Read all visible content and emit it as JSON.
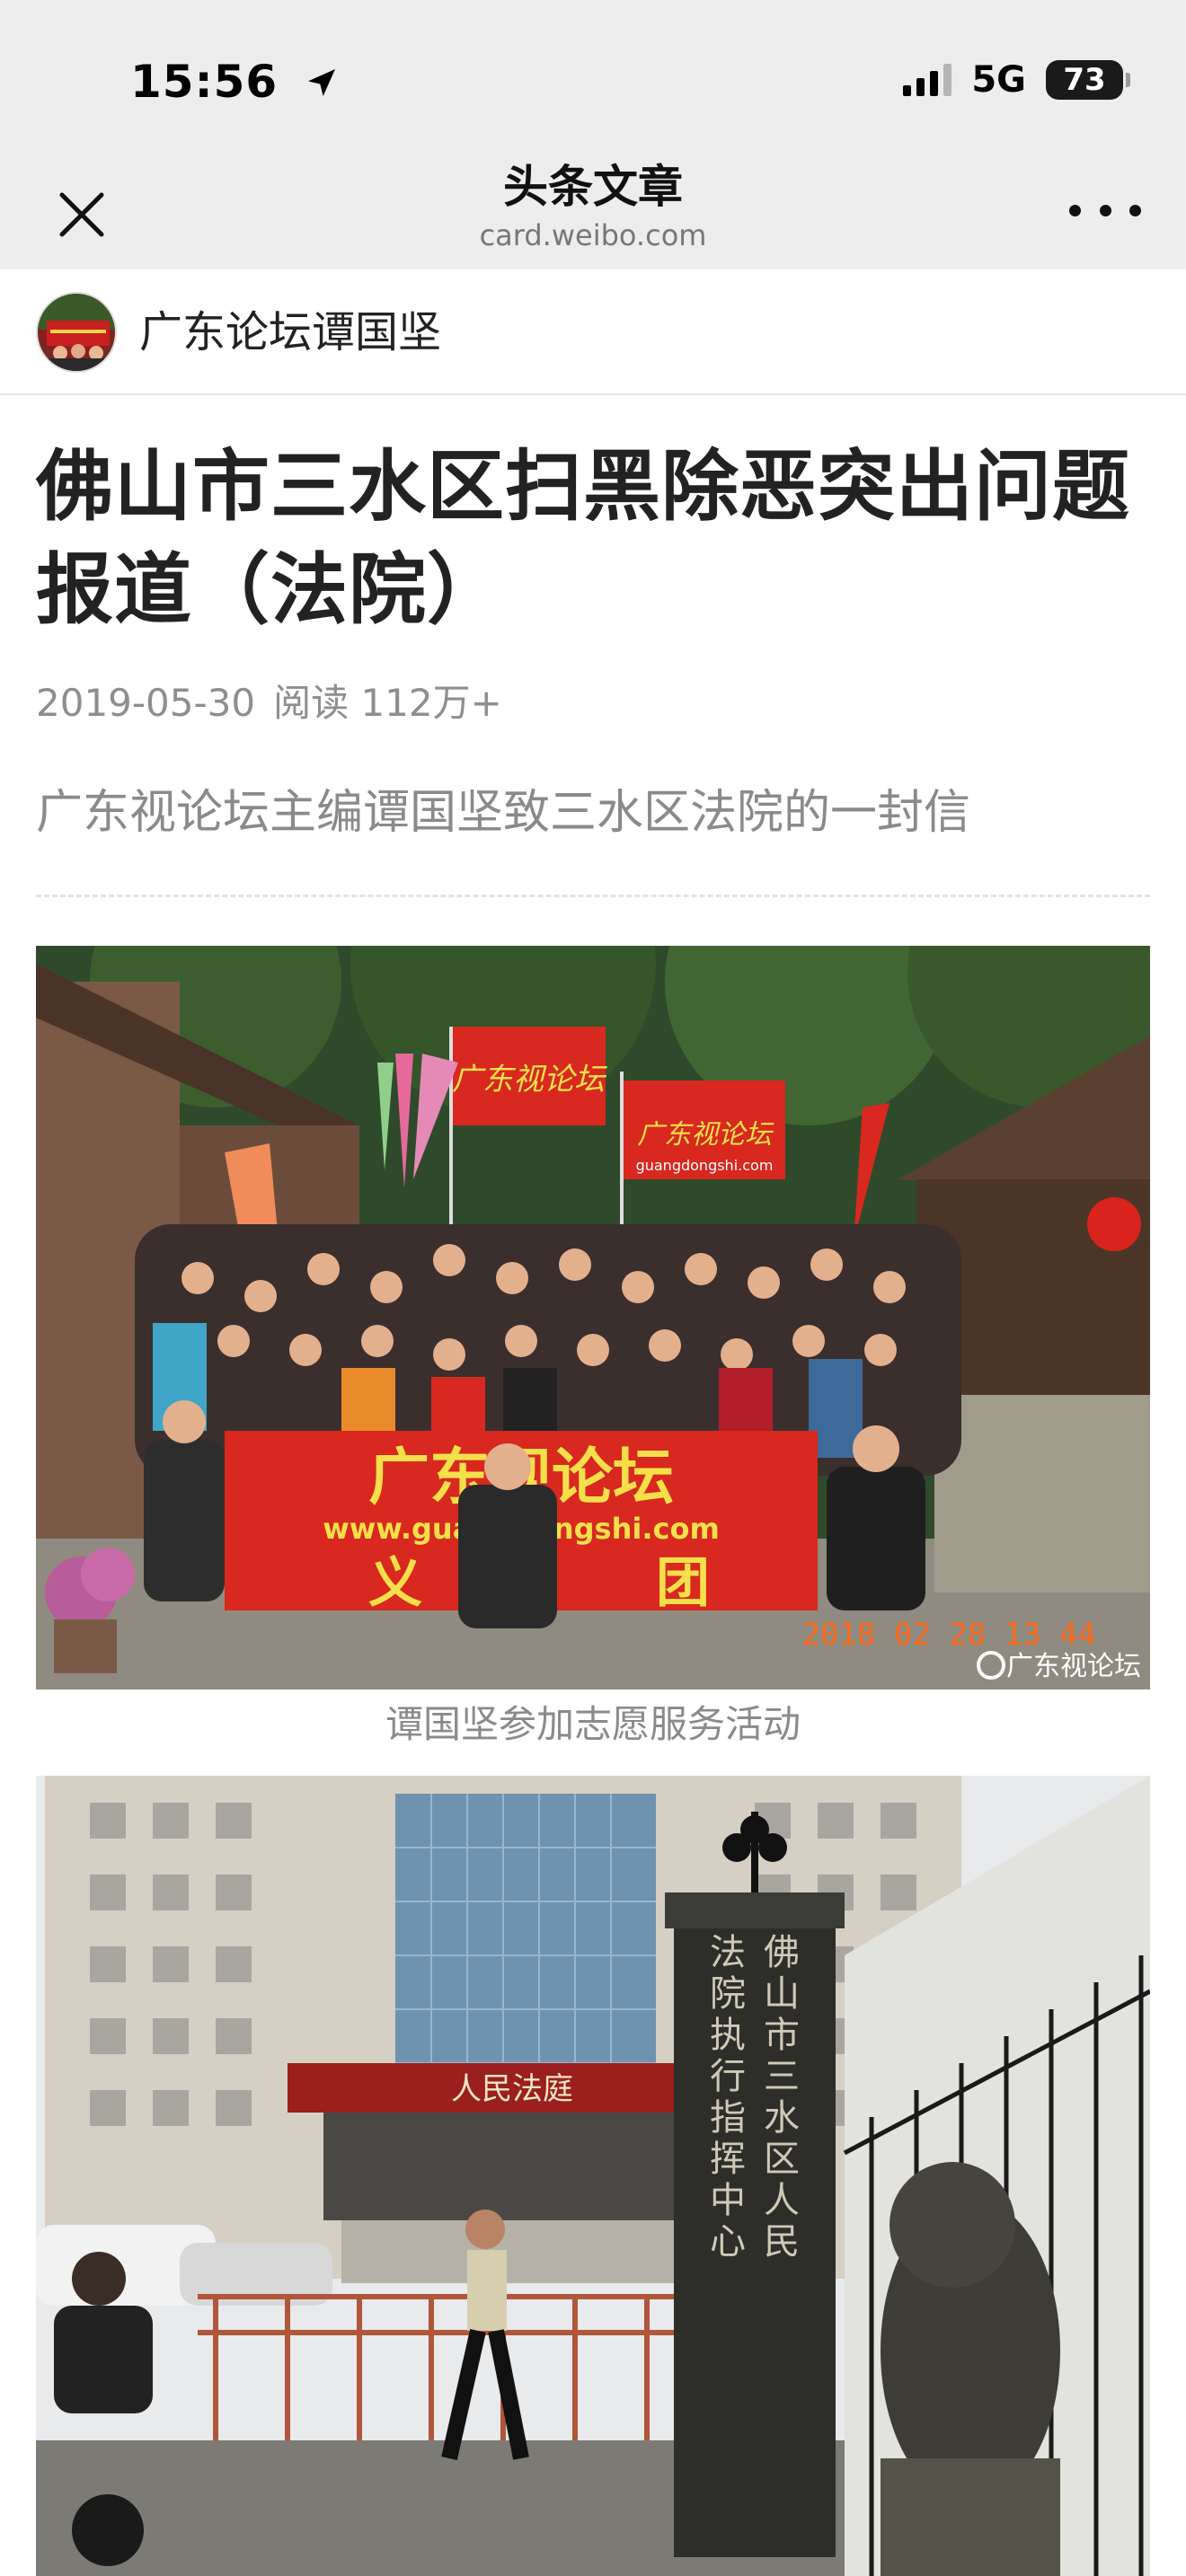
{
  "status_bar": {
    "time": "15:56",
    "network": "5G",
    "battery": "73"
  },
  "nav": {
    "title": "头条文章",
    "subtitle": "card.weibo.com"
  },
  "author": {
    "name": "广东论坛谭国坚"
  },
  "article": {
    "title": "佛山市三水区扫黑除恶突出问题报道（法院）",
    "date": "2019-05-30",
    "reads": "阅读 112万+",
    "lead": "广东视论坛主编谭国坚致三水区法院的一封信"
  },
  "photo1": {
    "banner_main": "广东视论坛",
    "banner_url": "www.guangdongshi.com",
    "banner_left": "义",
    "banner_right": "团",
    "flag_left": "广东视论坛",
    "flag_right": "广东视论坛",
    "flag_right_url": "guangdongshi.com",
    "timestamp": "2018 02 28 13 44",
    "watermark": "广东视论坛",
    "caption": "谭国坚参加志愿服务活动"
  },
  "photo2": {
    "building_sign": "人民法庭",
    "pillar_text": "佛山市三水区人民法院执行指挥中心"
  },
  "colors": {
    "chrome_bg": "#ededed",
    "banner_red": "#d8281f",
    "banner_text": "#f6e04a",
    "timestamp_orange": "#ff6a1a"
  },
  "icons": [
    "close-icon",
    "more-icon",
    "location-arrow-icon",
    "signal-icon",
    "battery-icon"
  ]
}
